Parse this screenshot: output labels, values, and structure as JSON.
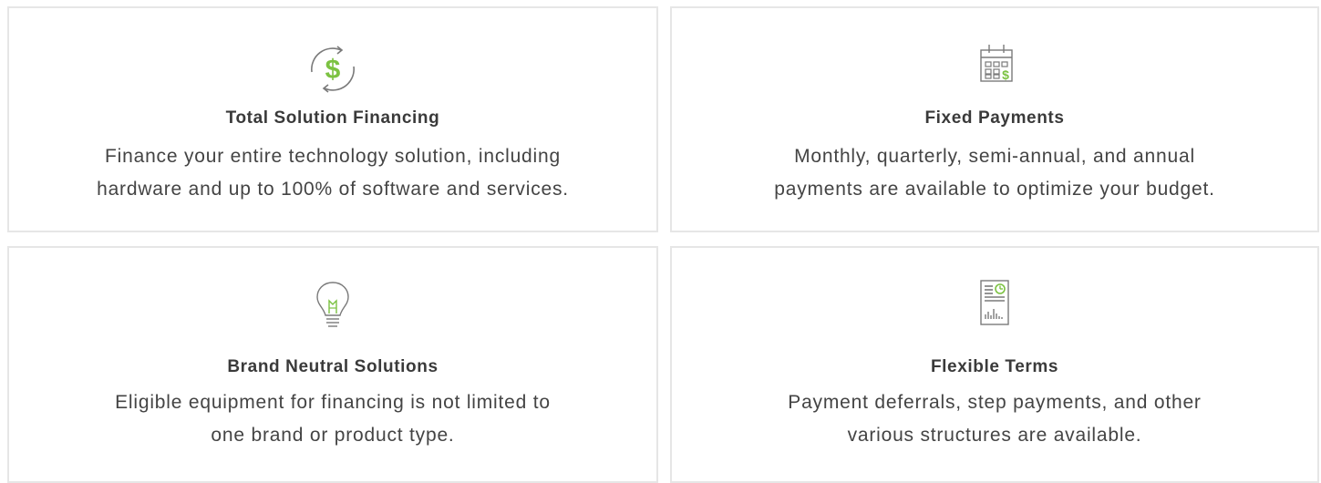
{
  "colors": {
    "accent": "#7cc242",
    "icon_stroke": "#7a7a7a",
    "border": "#e6e6e6",
    "text": "#444444"
  },
  "cards": [
    {
      "icon": "dollar-cycle-icon",
      "title": "Total Solution Financing",
      "line1": "Finance your entire technology solution, including",
      "line2": "hardware and up to 100% of software and services."
    },
    {
      "icon": "calendar-dollar-icon",
      "title": "Fixed Payments",
      "line1": "Monthly, quarterly, semi-annual, and annual",
      "line2": "payments are available to optimize your budget."
    },
    {
      "icon": "lightbulb-icon",
      "title": "Brand Neutral Solutions",
      "line1": "Eligible equipment for financing is not limited to",
      "line2": "one brand or product type."
    },
    {
      "icon": "report-chart-icon",
      "title": "Flexible Terms",
      "line1": "Payment deferrals, step payments, and other",
      "line2": "various structures are available."
    }
  ]
}
